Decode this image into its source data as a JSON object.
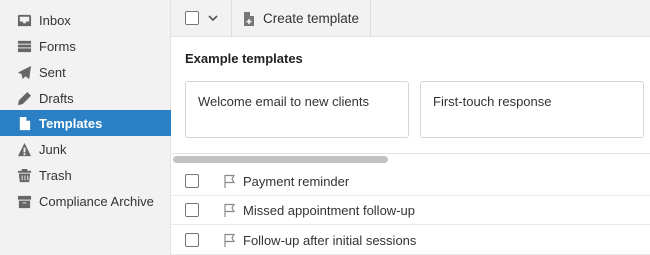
{
  "sidebar": {
    "items": [
      {
        "label": "Inbox",
        "icon": "inbox-icon",
        "active": false
      },
      {
        "label": "Forms",
        "icon": "forms-icon",
        "active": false
      },
      {
        "label": "Sent",
        "icon": "send-icon",
        "active": false
      },
      {
        "label": "Drafts",
        "icon": "pencil-icon",
        "active": false
      },
      {
        "label": "Templates",
        "icon": "document-icon",
        "active": true
      },
      {
        "label": "Junk",
        "icon": "warning-icon",
        "active": false
      },
      {
        "label": "Trash",
        "icon": "trash-icon",
        "active": false
      },
      {
        "label": "Compliance Archive",
        "icon": "archive-icon",
        "active": false
      }
    ]
  },
  "toolbar": {
    "create_label": "Create template"
  },
  "examples": {
    "title": "Example templates",
    "cards": [
      "Welcome email to new clients",
      "First-touch response"
    ]
  },
  "templates": [
    {
      "name": "Payment reminder"
    },
    {
      "name": "Missed appointment follow-up"
    },
    {
      "name": "Follow-up after initial sessions"
    }
  ],
  "colors": {
    "accent": "#2b80c5",
    "sidebar_bg": "#f2f2f2"
  }
}
